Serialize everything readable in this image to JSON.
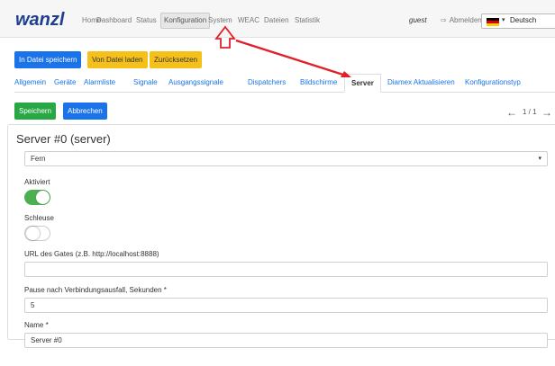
{
  "header": {
    "logo": "wanzl",
    "nav": [
      "Home",
      "Dashboard",
      "Status",
      "Konfiguration",
      "System",
      "WEAC",
      "Dateien",
      "Statistik"
    ],
    "active_nav": "Konfiguration",
    "user": "guest",
    "logout_label": "Abmelden",
    "language": "Deutsch"
  },
  "toolbar": {
    "save_file": "In Datei speichern",
    "load_file": "Von Datei laden",
    "reset": "Zurücksetzen"
  },
  "tabs": [
    "Allgemein",
    "Geräte",
    "Alarmliste",
    "Signale",
    "Ausgangssignale",
    "Dispatchers",
    "Bildschirme",
    "Server",
    "Diamex Aktualisieren",
    "Konfigurationstyp"
  ],
  "active_tab": "Server",
  "actions": {
    "save": "Speichern",
    "cancel": "Abbrechen"
  },
  "pager": {
    "text": "1 / 1"
  },
  "form": {
    "title": "Server #0 (server)",
    "mode_value": "Fern",
    "activated_label": "Aktiviert",
    "activated": true,
    "lock_label": "Schleuse",
    "lock": false,
    "gate_url_label": "URL des Gates (z.B. http://localhost:8888)",
    "gate_url_value": "",
    "pause_label": "Pause nach Verbindungsausfall, Sekunden *",
    "pause_value": "5",
    "name_label": "Name *",
    "name_value": "Server #0"
  },
  "colors": {
    "primary": "#1a73e8",
    "warning": "#f5c01a",
    "success": "#28a745",
    "toggle_on": "#4caf50",
    "annotation": "#e0202a",
    "logo": "#1f3f8f"
  }
}
